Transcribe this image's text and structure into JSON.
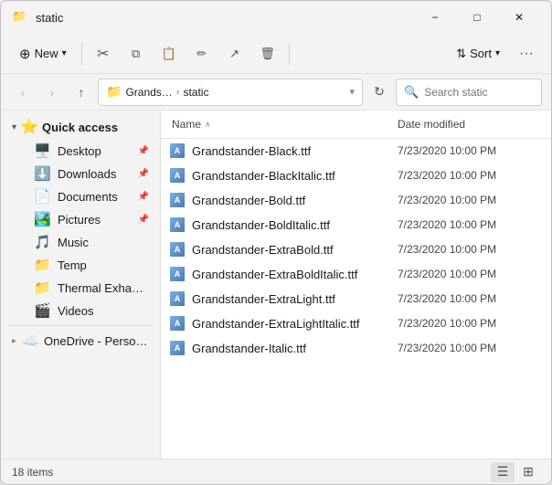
{
  "window": {
    "title": "static",
    "icon": "🗂️"
  },
  "titlebar": {
    "minimize_label": "−",
    "maximize_label": "□",
    "close_label": "✕"
  },
  "toolbar": {
    "new_label": "New",
    "sort_label": "Sort",
    "more_label": "···"
  },
  "addressbar": {
    "back_label": "‹",
    "forward_label": "›",
    "up_label": "↑",
    "breadcrumb_parent": "Grands…",
    "breadcrumb_sep": "›",
    "breadcrumb_current": "static",
    "refresh_label": "↻",
    "search_placeholder": "Search static"
  },
  "sidebar": {
    "quick_access_label": "Quick access",
    "items": [
      {
        "id": "desktop",
        "label": "Desktop",
        "icon": "🖥️",
        "pinned": true
      },
      {
        "id": "downloads",
        "label": "Downloads",
        "icon": "⬇️",
        "pinned": true
      },
      {
        "id": "documents",
        "label": "Documents",
        "icon": "📄",
        "pinned": true
      },
      {
        "id": "pictures",
        "label": "Pictures",
        "icon": "🏞️",
        "pinned": true
      },
      {
        "id": "music",
        "label": "Music",
        "icon": "🎵",
        "pinned": false
      },
      {
        "id": "temp",
        "label": "Temp",
        "icon": "📁",
        "pinned": false
      },
      {
        "id": "thermal",
        "label": "Thermal Exhau…",
        "icon": "📁",
        "pinned": false
      },
      {
        "id": "videos",
        "label": "Videos",
        "icon": "🎬",
        "pinned": false
      }
    ],
    "onedrive_label": "OneDrive - Perso…",
    "onedrive_icon": "☁️"
  },
  "filelist": {
    "col_name": "Name",
    "col_sort_icon": "∧",
    "col_date": "Date modified",
    "rows": [
      {
        "name": "Grandstander-Black.ttf",
        "date": "7/23/2020 10:00 PM"
      },
      {
        "name": "Grandstander-BlackItalic.ttf",
        "date": "7/23/2020 10:00 PM"
      },
      {
        "name": "Grandstander-Bold.ttf",
        "date": "7/23/2020 10:00 PM"
      },
      {
        "name": "Grandstander-BoldItalic.ttf",
        "date": "7/23/2020 10:00 PM"
      },
      {
        "name": "Grandstander-ExtraBold.ttf",
        "date": "7/23/2020 10:00 PM"
      },
      {
        "name": "Grandstander-ExtraBoldItalic.ttf",
        "date": "7/23/2020 10:00 PM"
      },
      {
        "name": "Grandstander-ExtraLight.ttf",
        "date": "7/23/2020 10:00 PM"
      },
      {
        "name": "Grandstander-ExtraLightItalic.ttf",
        "date": "7/23/2020 10:00 PM"
      },
      {
        "name": "Grandstander-Italic.ttf",
        "date": "7/23/2020 10:00 PM"
      }
    ]
  },
  "statusbar": {
    "count": "18 items"
  }
}
